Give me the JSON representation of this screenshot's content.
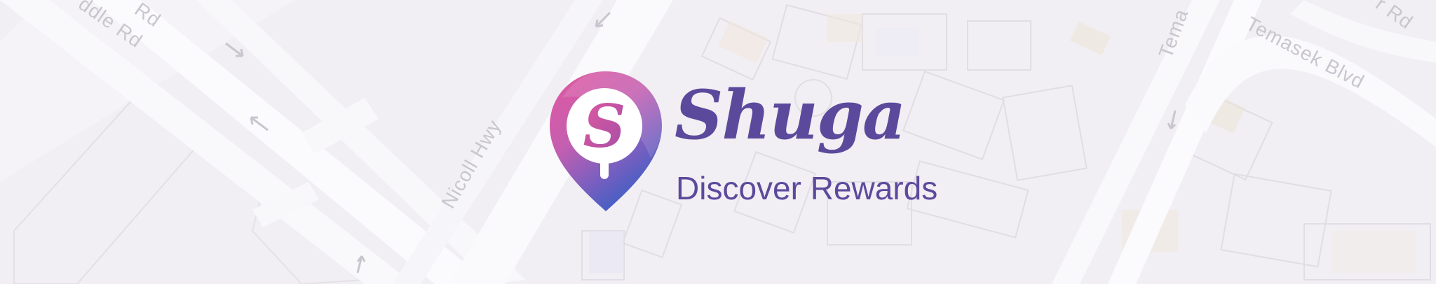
{
  "map": {
    "street_labels": [
      "Rd",
      "ddle Rd",
      "Nicoll Hwy",
      "Tema",
      "Temasek Blvd",
      "r Rd"
    ]
  },
  "logo": {
    "icon": "map-pin-s-icon",
    "brand_name": "Shuga",
    "tagline": "Discover Rewards"
  },
  "colors": {
    "brand_purple": "#5b4a9c",
    "pin_pink": "#e2589f",
    "pin_blue": "#3e5fc4"
  }
}
